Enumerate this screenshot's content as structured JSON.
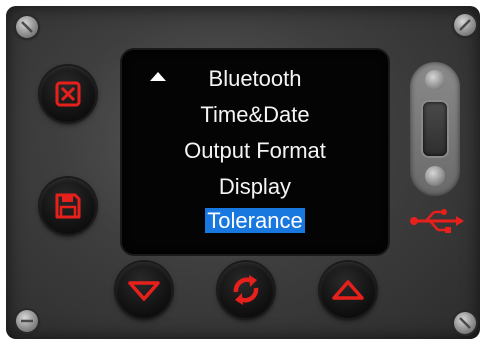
{
  "menu": {
    "items": [
      {
        "label": "Bluetooth",
        "selected": false
      },
      {
        "label": "Time&Date",
        "selected": false
      },
      {
        "label": "Output Format",
        "selected": false
      },
      {
        "label": "Display",
        "selected": false
      },
      {
        "label": "Tolerance",
        "selected": true
      }
    ],
    "scroll_up_icon": "triangle-up-icon",
    "selection_color": "#1977e0"
  },
  "buttons": {
    "cancel": {
      "icon": "x-box-icon"
    },
    "save": {
      "icon": "floppy-disk-icon"
    },
    "down": {
      "icon": "triangle-down-icon"
    },
    "enter": {
      "icon": "refresh-cycle-icon"
    },
    "up": {
      "icon": "triangle-up-icon"
    }
  },
  "colors": {
    "button_icon": "#e8201c",
    "usb_symbol": "#e8201c",
    "panel": "#3e3e3e",
    "screen": "#040404"
  },
  "usb": {
    "icon": "usb-symbol-icon"
  }
}
